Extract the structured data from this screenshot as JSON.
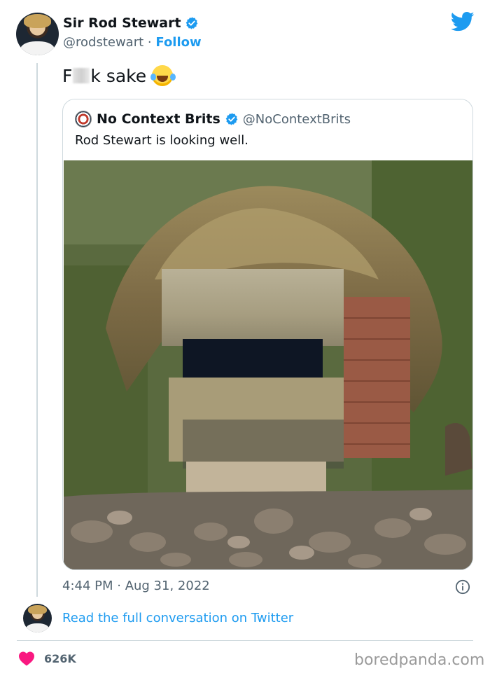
{
  "author": {
    "display_name": "Sir Rod Stewart",
    "handle": "@rodstewart",
    "separator": "·",
    "follow_label": "Follow"
  },
  "tweet": {
    "text_start": "F",
    "text_end": "k sake"
  },
  "quoted": {
    "display_name": "No Context Brits",
    "handle": "@NoContextBrits",
    "text": "Rod Stewart is looking well."
  },
  "meta": {
    "timestamp": "4:44 PM · Aug 31, 2022",
    "read_conversation": "Read the full conversation on Twitter",
    "likes": "626K"
  },
  "watermark": "boredpanda.com",
  "colors": {
    "twitter_blue": "#1d9bf0",
    "like_pink": "#f91880",
    "muted_text": "#536471"
  },
  "icons": [
    "verified-badge-icon",
    "twitter-bird-icon",
    "info-icon",
    "heart-icon"
  ]
}
